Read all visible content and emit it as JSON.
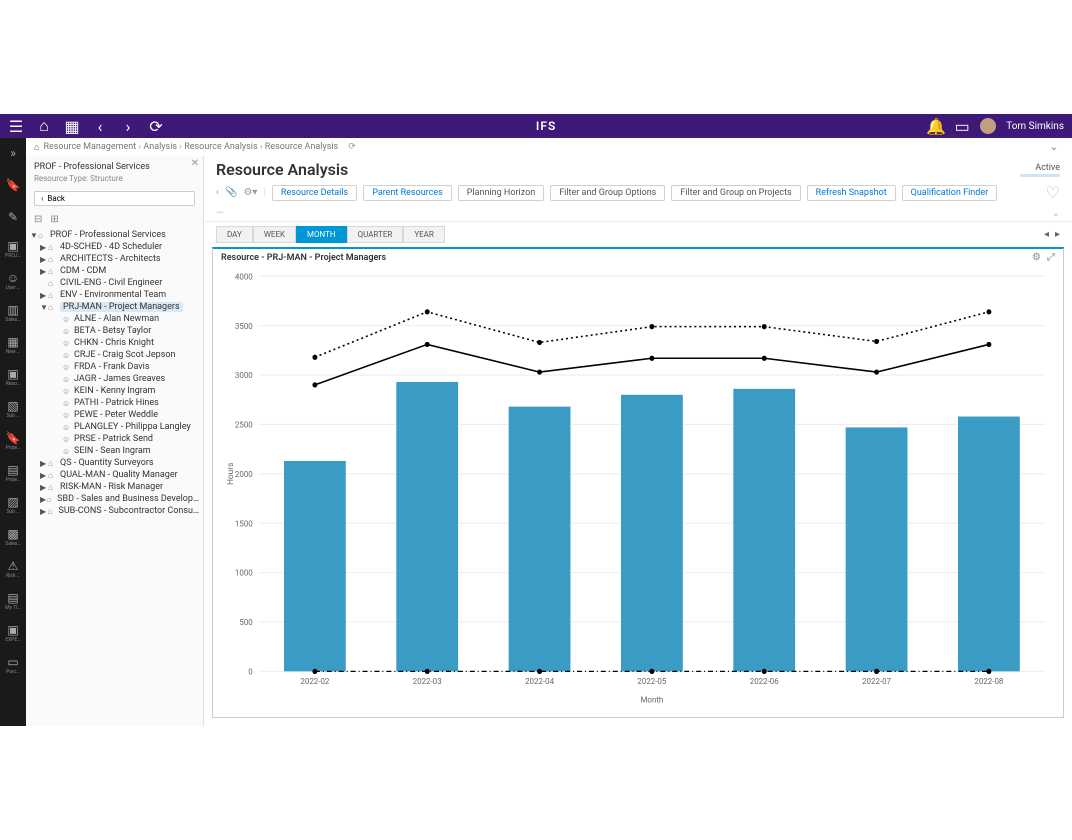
{
  "topbar": {
    "brand": "IFS",
    "user": "Tom Simkins"
  },
  "breadcrumb": [
    "Resource Management",
    "Analysis",
    "Resource Analysis",
    "Resource Analysis"
  ],
  "sidebar": {
    "title": "PROF - Professional Services",
    "subtitle_label": "Resource Type:",
    "subtitle_value": "Structure",
    "back": "Back",
    "root": "PROF - Professional Services",
    "nodes": [
      {
        "d": 1,
        "caret": "▶",
        "icon": "⌂",
        "label": "4D-SCHED - 4D Scheduler"
      },
      {
        "d": 1,
        "caret": "▶",
        "icon": "⌂",
        "label": "ARCHITECTS - Architects"
      },
      {
        "d": 1,
        "caret": "▶",
        "icon": "⌂",
        "label": "CDM - CDM"
      },
      {
        "d": 1,
        "caret": "",
        "icon": "⌂",
        "label": "CIVIL-ENG - Civil Engineer"
      },
      {
        "d": 1,
        "caret": "▶",
        "icon": "⌂",
        "label": "ENV - Environmental Team"
      },
      {
        "d": 1,
        "caret": "▼",
        "icon": "⌂",
        "label": "PRJ-MAN - Project Managers",
        "selected": true
      },
      {
        "d": 2,
        "caret": "",
        "icon": "☺",
        "label": "ALNE - Alan Newman"
      },
      {
        "d": 2,
        "caret": "",
        "icon": "☺",
        "label": "BETA - Betsy Taylor"
      },
      {
        "d": 2,
        "caret": "",
        "icon": "☺",
        "label": "CHKN - Chris Knight"
      },
      {
        "d": 2,
        "caret": "",
        "icon": "☺",
        "label": "CRJE - Craig Scot Jepson"
      },
      {
        "d": 2,
        "caret": "",
        "icon": "☺",
        "label": "FRDA - Frank Davis"
      },
      {
        "d": 2,
        "caret": "",
        "icon": "☺",
        "label": "JAGR - James Greaves"
      },
      {
        "d": 2,
        "caret": "",
        "icon": "☺",
        "label": "KEIN - Kenny Ingram"
      },
      {
        "d": 2,
        "caret": "",
        "icon": "☺",
        "label": "PATHI - Patrick Hines"
      },
      {
        "d": 2,
        "caret": "",
        "icon": "☺",
        "label": "PEWE - Peter Weddle"
      },
      {
        "d": 2,
        "caret": "",
        "icon": "☺",
        "label": "PLANGLEY - Philippa Langley"
      },
      {
        "d": 2,
        "caret": "",
        "icon": "☺",
        "label": "PRSE - Patrick Send"
      },
      {
        "d": 2,
        "caret": "",
        "icon": "☺",
        "label": "SEIN - Sean Ingram"
      },
      {
        "d": 1,
        "caret": "▶",
        "icon": "⌂",
        "label": "QS - Quantity Surveyors"
      },
      {
        "d": 1,
        "caret": "▶",
        "icon": "⌂",
        "label": "QUAL-MAN - Quality Manager"
      },
      {
        "d": 1,
        "caret": "▶",
        "icon": "⌂",
        "label": "RISK-MAN - Risk Manager"
      },
      {
        "d": 1,
        "caret": "▶",
        "icon": "⌂",
        "label": "SBD - Sales and Business Develop…"
      },
      {
        "d": 1,
        "caret": "▶",
        "icon": "⌂",
        "label": "SUB-CONS - Subcontractor Consu…"
      }
    ]
  },
  "rail": [
    {
      "label": "",
      "icon": "»"
    },
    {
      "label": "",
      "icon": "🔖"
    },
    {
      "label": "",
      "icon": "✎"
    },
    {
      "label": "PROJ…",
      "icon": "▣"
    },
    {
      "label": "User …",
      "icon": "☺"
    },
    {
      "label": "Sales…",
      "icon": "▥"
    },
    {
      "label": "New …",
      "icon": "▦"
    },
    {
      "label": "Reso…",
      "icon": "▣"
    },
    {
      "label": "Sub …",
      "icon": "▧"
    },
    {
      "label": "Proje…",
      "icon": "🔖"
    },
    {
      "label": "Proje…",
      "icon": "▤"
    },
    {
      "label": "Sub …",
      "icon": "▨"
    },
    {
      "label": "Sales…",
      "icon": "▩"
    },
    {
      "label": "Risk …",
      "icon": "⚠"
    },
    {
      "label": "My TI…",
      "icon": "▤"
    },
    {
      "label": "EXPE…",
      "icon": "▣"
    },
    {
      "label": "Purc…",
      "icon": "▭"
    }
  ],
  "page": {
    "title": "Resource Analysis",
    "status": "Active",
    "actions": [
      {
        "label": "Resource Details",
        "link": true
      },
      {
        "label": "Parent Resources",
        "link": true
      },
      {
        "label": "Planning Horizon",
        "link": false
      },
      {
        "label": "Filter and Group Options",
        "link": false
      },
      {
        "label": "Filter and Group on Projects",
        "link": false
      },
      {
        "label": "Refresh Snapshot",
        "link": true
      },
      {
        "label": "Qualification Finder",
        "link": true
      }
    ],
    "expand_placeholder": "—"
  },
  "timescale": {
    "tabs": [
      "DAY",
      "WEEK",
      "MONTH",
      "QUARTER",
      "YEAR"
    ],
    "active": "MONTH"
  },
  "chart": {
    "title": "Resource - PRJ-MAN - Project Managers",
    "ylabel": "Hours",
    "xlabel": "Month"
  },
  "chart_data": {
    "type": "bar",
    "categories": [
      "2022-02",
      "2022-03",
      "2022-04",
      "2022-05",
      "2022-06",
      "2022-07",
      "2022-08"
    ],
    "series": [
      {
        "name": "Bars",
        "kind": "bar",
        "values": [
          2130,
          2930,
          2680,
          2800,
          2860,
          2470,
          2580
        ]
      },
      {
        "name": "Solid line",
        "kind": "line-solid",
        "values": [
          2900,
          3310,
          3030,
          3170,
          3170,
          3030,
          3310
        ]
      },
      {
        "name": "Dotted line",
        "kind": "line-dotted",
        "values": [
          3180,
          3640,
          3330,
          3490,
          3490,
          3340,
          3640
        ]
      },
      {
        "name": "Dashed baseline",
        "kind": "line-dashed",
        "values": [
          0,
          0,
          0,
          0,
          0,
          0,
          0
        ]
      }
    ],
    "ylabel": "Hours",
    "xlabel": "Month",
    "ylim": [
      0,
      4000
    ],
    "yticks": [
      0,
      500,
      1000,
      1500,
      2000,
      2500,
      3000,
      3500,
      4000
    ]
  }
}
